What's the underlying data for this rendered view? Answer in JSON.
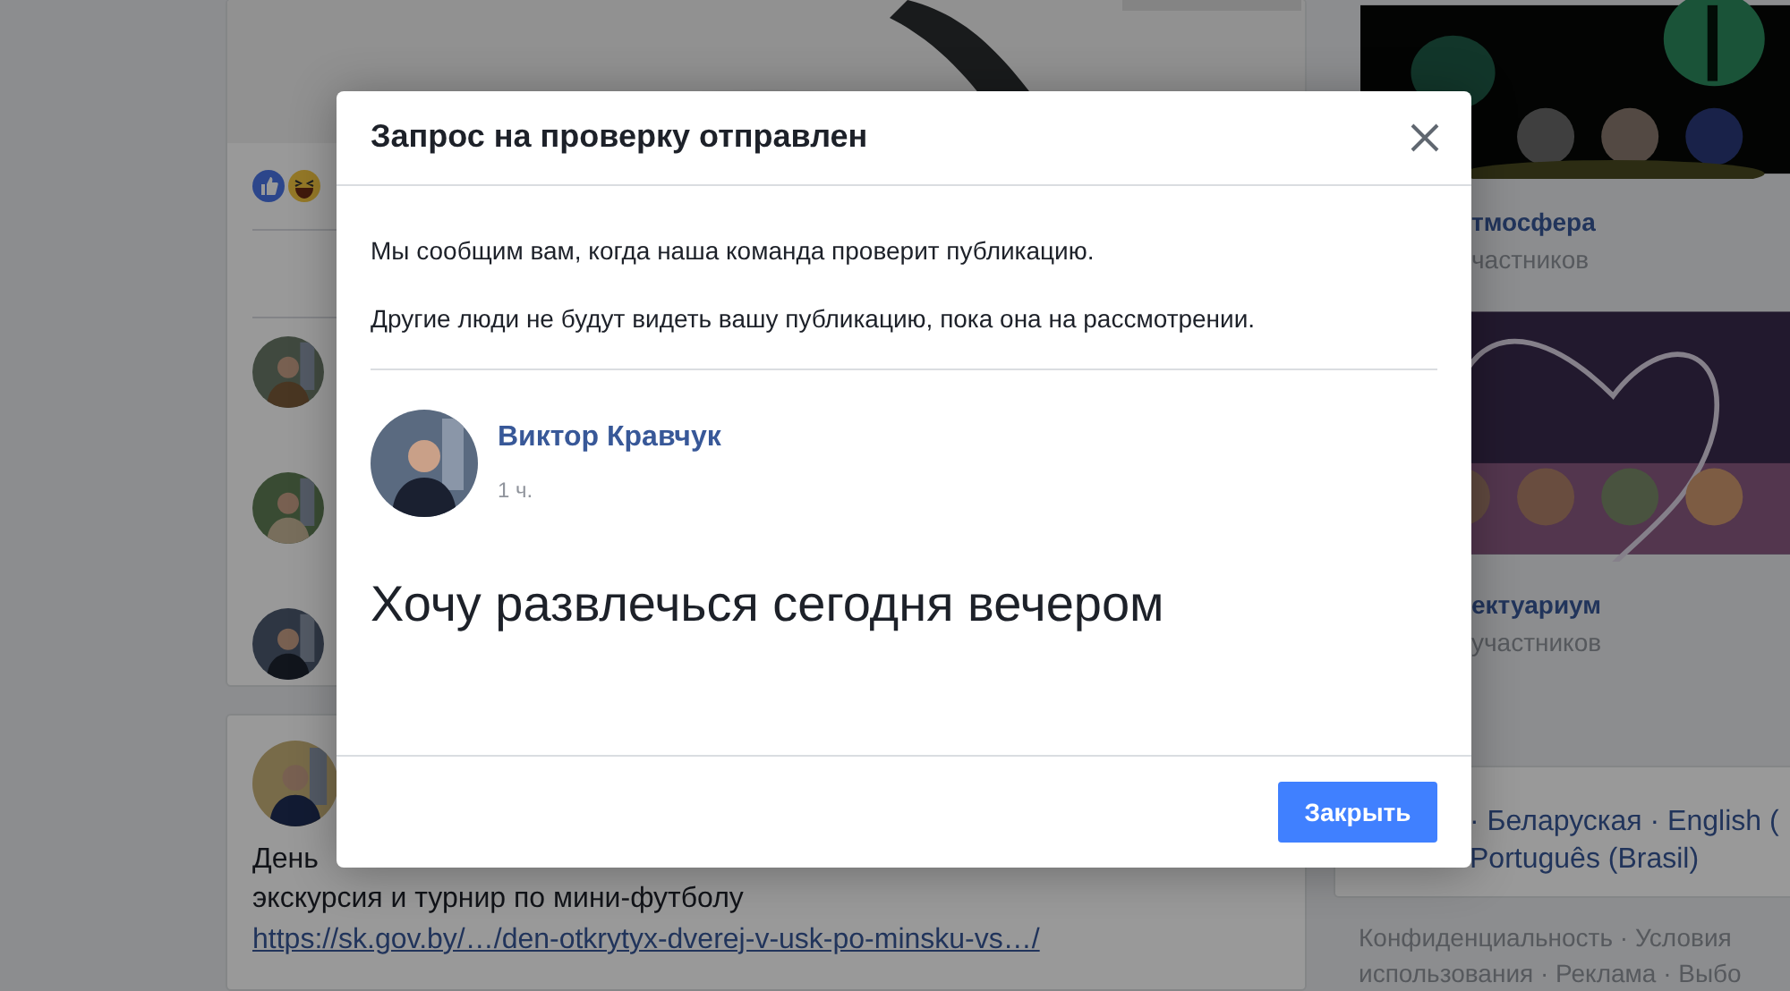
{
  "background": {
    "feed": {
      "post_lines": [
        "День",
        "экскурсия и турнир по мини-футболу"
      ],
      "post_link": "https://sk.gov.by/…/den-otkrytyx-dverej-v-usk-po-minsku-vs…/"
    },
    "groups": [
      {
        "name": "тмосфера",
        "members": "частников",
        "kind": "night"
      },
      {
        "name": "ектуариум",
        "members": "участников",
        "kind": "dusk"
      }
    ],
    "languages": [
      "· Беларуская · English (",
      "Português (Brasil)"
    ],
    "footer_lines": [
      "Конфиденциальность · Условия",
      "использования · Реклама · Выбо"
    ]
  },
  "dialog": {
    "title": "Запрос на проверку отправлен",
    "messages": [
      "Мы сообщим вам, когда наша команда проверит публикацию.",
      "Другие люди не будут видеть вашу публикацию, пока она на рассмотрении."
    ],
    "post": {
      "author": "Виктор Кравчук",
      "time": "1 ч.",
      "text": "Хочу развлечься сегодня вечером"
    },
    "close_button": "Закрыть"
  }
}
